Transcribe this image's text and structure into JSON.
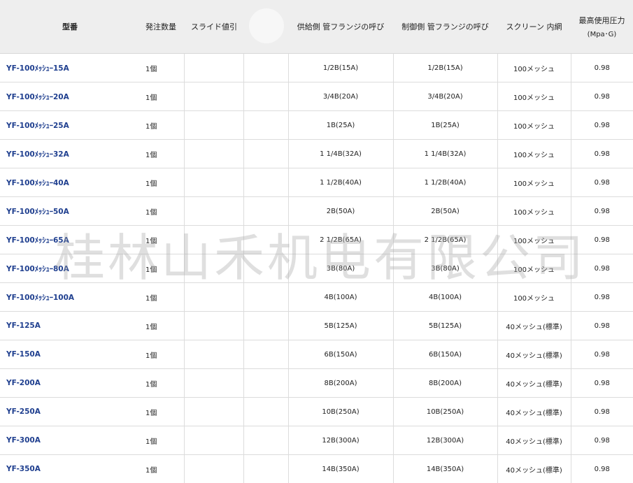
{
  "headers": {
    "model": "型番",
    "order_qty": "発注数量",
    "slide_price": "スライド値引",
    "supply_flange": "供給側 管フランジの呼び",
    "control_flange": "制御側 管フランジの呼び",
    "screen_mesh": "スクリーン 内網",
    "max_pressure": "最高使用圧力",
    "max_pressure_unit": "(Mpa･G)"
  },
  "rows": [
    {
      "model": "YF-100ﾒｯｼｭｰ15A",
      "qty": "1個",
      "supply": "1/2B(15A)",
      "control": "1/2B(15A)",
      "mesh": "100メッシュ",
      "pressure": "0.98"
    },
    {
      "model": "YF-100ﾒｯｼｭｰ20A",
      "qty": "1個",
      "supply": "3/4B(20A)",
      "control": "3/4B(20A)",
      "mesh": "100メッシュ",
      "pressure": "0.98"
    },
    {
      "model": "YF-100ﾒｯｼｭｰ25A",
      "qty": "1個",
      "supply": "1B(25A)",
      "control": "1B(25A)",
      "mesh": "100メッシュ",
      "pressure": "0.98"
    },
    {
      "model": "YF-100ﾒｯｼｭｰ32A",
      "qty": "1個",
      "supply": "1 1/4B(32A)",
      "control": "1 1/4B(32A)",
      "mesh": "100メッシュ",
      "pressure": "0.98"
    },
    {
      "model": "YF-100ﾒｯｼｭｰ40A",
      "qty": "1個",
      "supply": "1 1/2B(40A)",
      "control": "1 1/2B(40A)",
      "mesh": "100メッシュ",
      "pressure": "0.98"
    },
    {
      "model": "YF-100ﾒｯｼｭｰ50A",
      "qty": "1個",
      "supply": "2B(50A)",
      "control": "2B(50A)",
      "mesh": "100メッシュ",
      "pressure": "0.98"
    },
    {
      "model": "YF-100ﾒｯｼｭｰ65A",
      "qty": "1個",
      "supply": "2 1/2B(65A)",
      "control": "2 1/2B(65A)",
      "mesh": "100メッシュ",
      "pressure": "0.98"
    },
    {
      "model": "YF-100ﾒｯｼｭｰ80A",
      "qty": "1個",
      "supply": "3B(80A)",
      "control": "3B(80A)",
      "mesh": "100メッシュ",
      "pressure": "0.98"
    },
    {
      "model": "YF-100ﾒｯｼｭｰ100A",
      "qty": "1個",
      "supply": "4B(100A)",
      "control": "4B(100A)",
      "mesh": "100メッシュ",
      "pressure": "0.98"
    },
    {
      "model": "YF-125A",
      "qty": "1個",
      "supply": "5B(125A)",
      "control": "5B(125A)",
      "mesh": "40メッシュ(標準)",
      "pressure": "0.98"
    },
    {
      "model": "YF-150A",
      "qty": "1個",
      "supply": "6B(150A)",
      "control": "6B(150A)",
      "mesh": "40メッシュ(標準)",
      "pressure": "0.98"
    },
    {
      "model": "YF-200A",
      "qty": "1個",
      "supply": "8B(200A)",
      "control": "8B(200A)",
      "mesh": "40メッシュ(標準)",
      "pressure": "0.98"
    },
    {
      "model": "YF-250A",
      "qty": "1個",
      "supply": "10B(250A)",
      "control": "10B(250A)",
      "mesh": "40メッシュ(標準)",
      "pressure": "0.98"
    },
    {
      "model": "YF-300A",
      "qty": "1個",
      "supply": "12B(300A)",
      "control": "12B(300A)",
      "mesh": "40メッシュ(標準)",
      "pressure": "0.98"
    },
    {
      "model": "YF-350A",
      "qty": "1個",
      "supply": "14B(350A)",
      "control": "14B(350A)",
      "mesh": "40メッシュ(標準)",
      "pressure": "0.98"
    }
  ],
  "watermark": "桂林山禾机电有限公司"
}
